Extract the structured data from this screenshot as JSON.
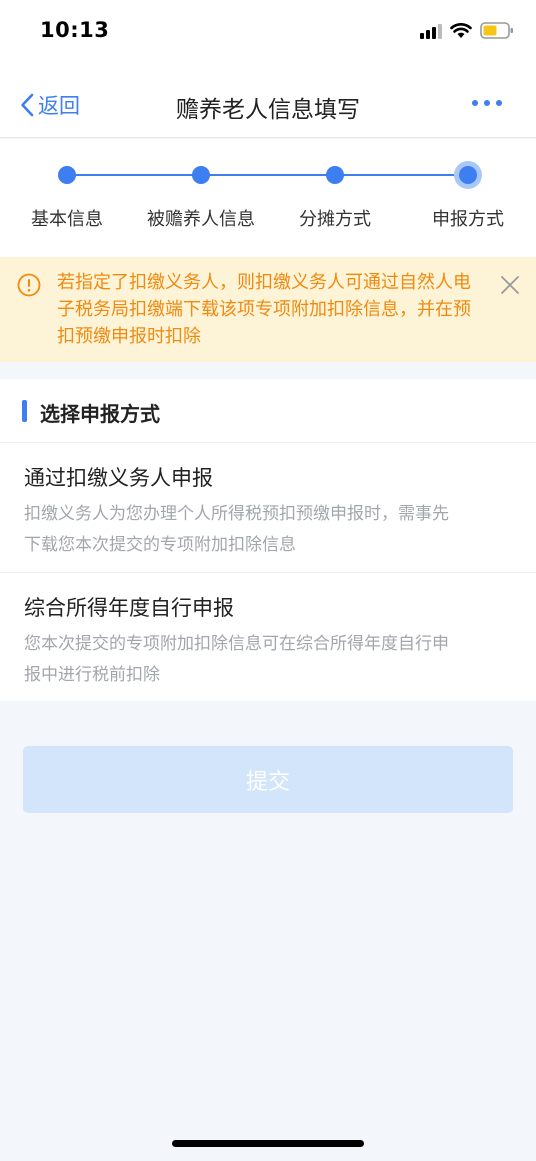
{
  "status_bar": {
    "time": "10:13"
  },
  "nav": {
    "back_label": "返回",
    "title": "赡养老人信息填写"
  },
  "steps": [
    {
      "label": "基本信息",
      "state": "done"
    },
    {
      "label": "被赡养人信息",
      "state": "done"
    },
    {
      "label": "分摊方式",
      "state": "done"
    },
    {
      "label": "申报方式",
      "state": "current"
    }
  ],
  "notice": {
    "text": "若指定了扣缴义务人，则扣缴义务人可通过自然人电子税务局扣缴端下载该项专项附加扣除信息，并在预扣预缴申报时扣除",
    "color": "#f08a0f"
  },
  "section": {
    "title": "选择申报方式",
    "options": [
      {
        "title": "通过扣缴义务人申报",
        "desc": "扣缴义务人为您办理个人所得税预扣预缴申报时，需事先下载您本次提交的专项附加扣除信息"
      },
      {
        "title": "综合所得年度自行申报",
        "desc": "您本次提交的专项附加扣除信息可在综合所得年度自行申报中进行税前扣除"
      }
    ]
  },
  "submit": {
    "label": "提交"
  },
  "colors": {
    "accent": "#3d7ef0",
    "notice_bg": "#fdf4d8"
  }
}
